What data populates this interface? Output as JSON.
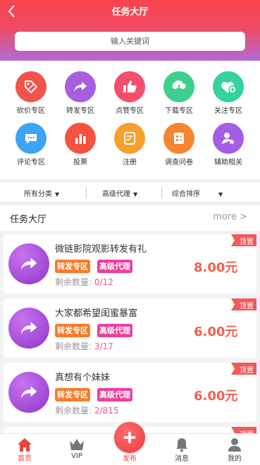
{
  "header": {
    "title": "任务大厅"
  },
  "search": {
    "placeholder": "输入关键词"
  },
  "categories": [
    {
      "label": "砍价专区",
      "icon": "tag-icon",
      "color": "#f4524c"
    },
    {
      "label": "转发专区",
      "icon": "share-arrow-icon",
      "color": "#a75fe0"
    },
    {
      "label": "点赞专区",
      "icon": "thumbs-up-icon",
      "color": "#f44e6c"
    },
    {
      "label": "下载专区",
      "icon": "download-icon",
      "color": "#3ecf8f"
    },
    {
      "label": "关注专区",
      "icon": "heart-plus-icon",
      "color": "#33d39b"
    },
    {
      "label": "评论专区",
      "icon": "comment-icon",
      "color": "#3ea3f0"
    },
    {
      "label": "投票",
      "icon": "bar-chart-icon",
      "color": "#f5523f"
    },
    {
      "label": "注册",
      "icon": "register-icon",
      "color": "#f6a02e"
    },
    {
      "label": "调查问卷",
      "icon": "survey-icon",
      "color": "#f5852e"
    },
    {
      "label": "辅助相关",
      "icon": "user-star-icon",
      "color": "#a45ee6"
    }
  ],
  "filters": [
    {
      "label": "所有分类"
    },
    {
      "label": "高级代理"
    },
    {
      "label": "综合排序"
    }
  ],
  "section": {
    "title": "任务大厅",
    "more": "more >"
  },
  "tasks": [
    {
      "name": "微链影院观影转发有礼",
      "tag1": "转发专区",
      "tag2": "高级代理",
      "remain_label": "剩余数量:",
      "remain": "0/12",
      "price": "8.00元",
      "badge": "顶置"
    },
    {
      "name": "大家都希望闺蜜暴富",
      "tag1": "转发专区",
      "tag2": "高级代理",
      "remain_label": "剩余数量:",
      "remain": "3/17",
      "price": "6.00元",
      "badge": "顶置"
    },
    {
      "name": "真想有个妹妹",
      "tag1": "转发专区",
      "tag2": "高级代理",
      "remain_label": "剩余数量:",
      "remain": "2/815",
      "price": "6.00元",
      "badge": "顶置"
    },
    {
      "name": "",
      "tag1": "",
      "tag2": "",
      "remain_label": "",
      "remain": "",
      "price": "",
      "badge": "顶置"
    }
  ],
  "tabbar": [
    {
      "label": "首页",
      "icon": "home-icon"
    },
    {
      "label": "VIP",
      "icon": "crown-icon"
    },
    {
      "label": "发布",
      "icon": "plus-icon"
    },
    {
      "label": "消息",
      "icon": "bell-icon"
    },
    {
      "label": "我的",
      "icon": "user-icon"
    }
  ],
  "colors": {
    "header_top": "#f8444c",
    "header_bottom": "#b36ad8",
    "price": "#f26150",
    "active_tab": "#e8453c"
  }
}
